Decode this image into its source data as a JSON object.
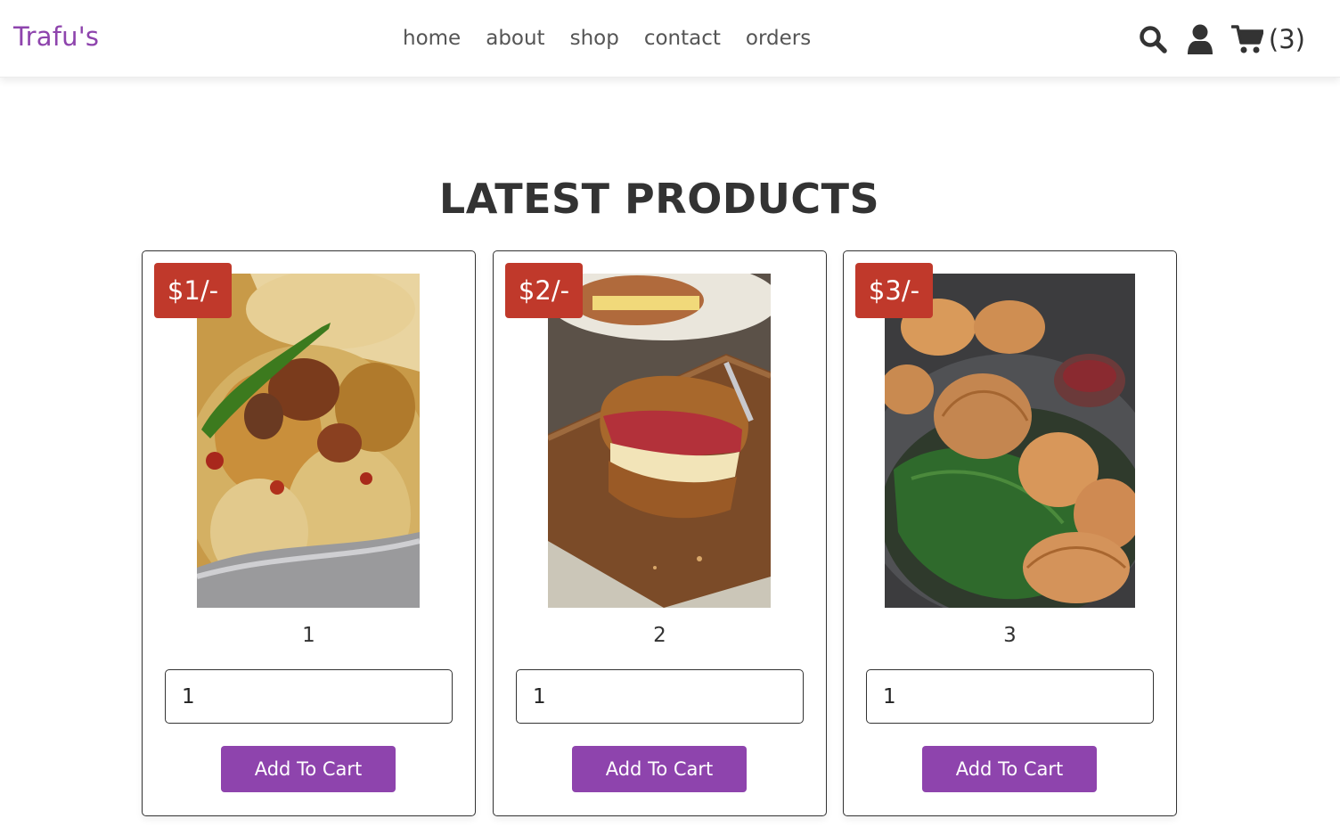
{
  "header": {
    "logo": "Trafu's",
    "nav": [
      {
        "label": "home"
      },
      {
        "label": "about"
      },
      {
        "label": "shop"
      },
      {
        "label": "contact"
      },
      {
        "label": "orders"
      }
    ],
    "icons": {
      "search": "search-icon",
      "user": "user-icon",
      "cart": "cart-icon"
    },
    "cart_count": "(3)"
  },
  "main": {
    "heading": "LATEST PRODUCTS",
    "products": [
      {
        "price": "$1/-",
        "name": "1",
        "quantity": "1",
        "button": "Add To Cart",
        "image": "biryani-photo"
      },
      {
        "price": "$2/-",
        "name": "2",
        "quantity": "1",
        "button": "Add To Cart",
        "image": "sandwich-photo"
      },
      {
        "price": "$3/-",
        "name": "3",
        "quantity": "1",
        "button": "Add To Cart",
        "image": "momos-photo"
      }
    ]
  },
  "colors": {
    "brand": "#8e44ad",
    "price_badge": "#c0392b",
    "text": "#333333"
  }
}
